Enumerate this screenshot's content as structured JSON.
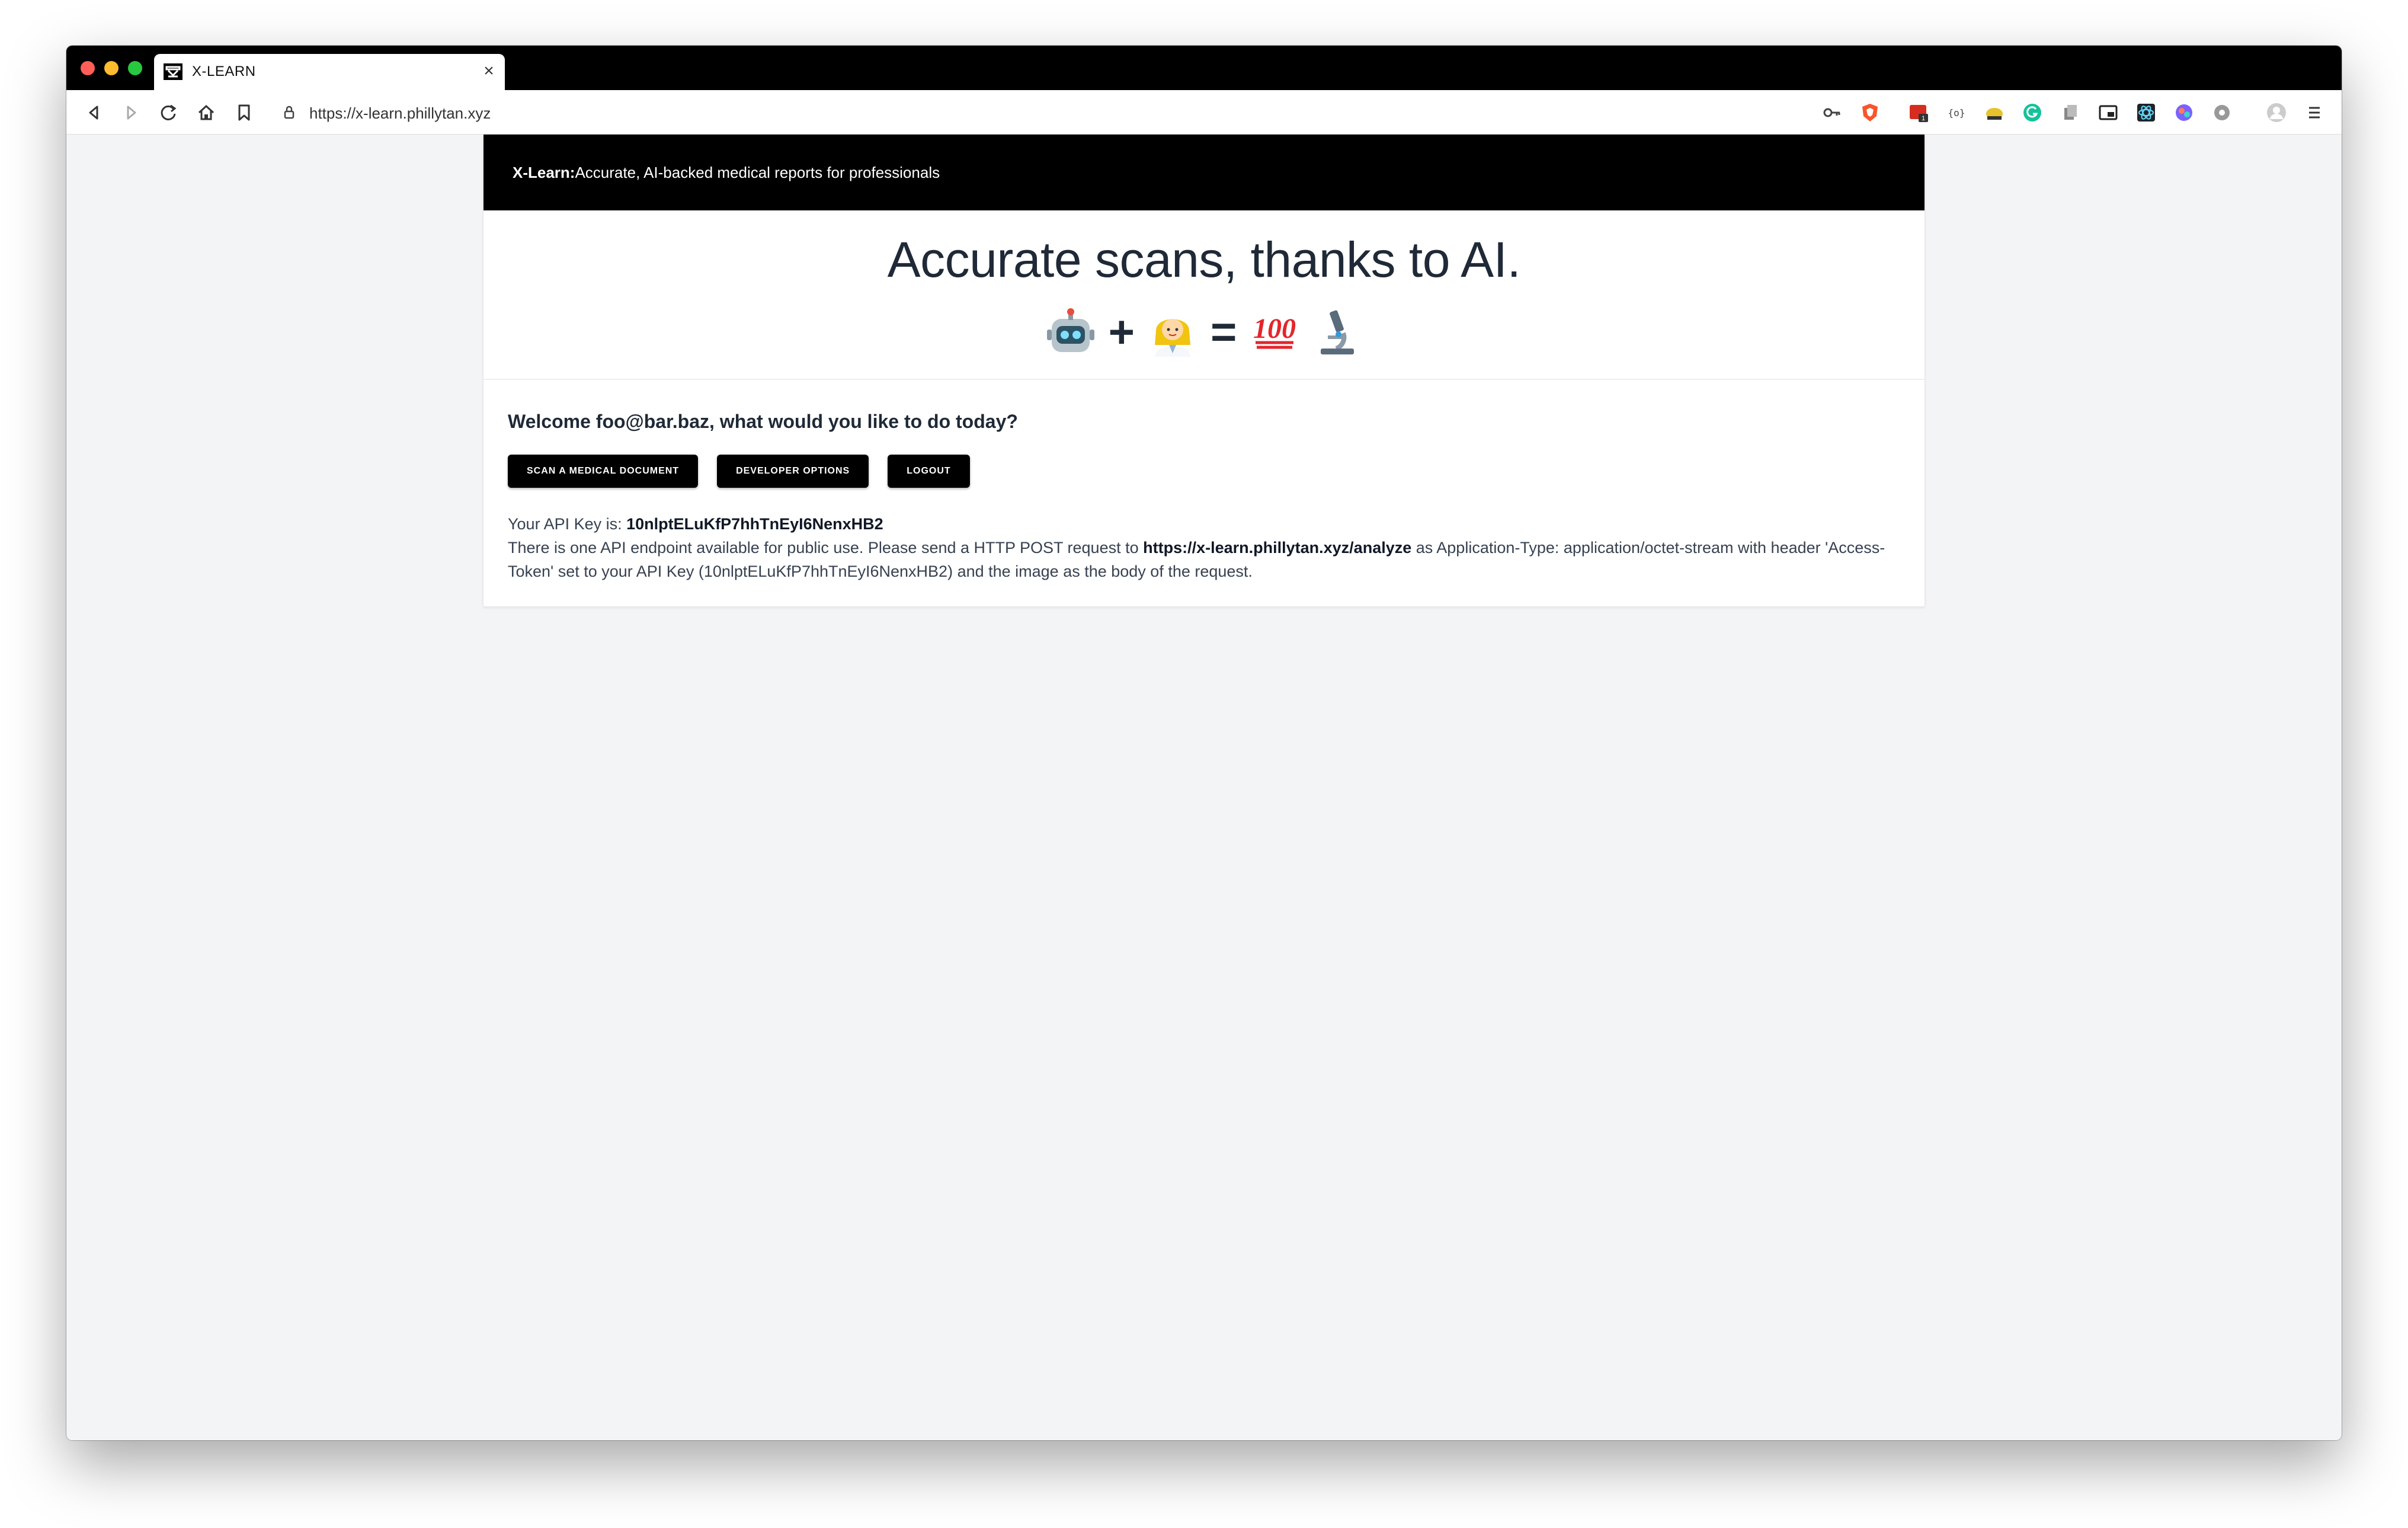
{
  "browser": {
    "tab_title": "X-LEARN",
    "tab_close": "×",
    "new_tab": "+",
    "url": "https://x-learn.phillytan.xyz"
  },
  "header": {
    "brand": "X-Learn:",
    "tagline": "Accurate, AI-backed medical reports for professionals"
  },
  "hero": {
    "title": "Accurate scans, thanks to AI.",
    "plus": "+",
    "equals": "="
  },
  "main": {
    "welcome": "Welcome foo@bar.baz, what would you like to do today?",
    "buttons": {
      "scan": "SCAN A MEDICAL DOCUMENT",
      "developer": "DEVELOPER OPTIONS",
      "logout": "LOGOUT"
    },
    "api_key_label": "Your API Key is: ",
    "api_key": "10nlptELuKfP7hhTnEyI6NenxHB2",
    "endpoint_text_1": "There is one API endpoint available for public use. Please send a HTTP POST request to ",
    "endpoint_url": "https://x-learn.phillytan.xyz/analyze",
    "endpoint_text_2": " as Application-Type: application/octet-stream with header 'Access-Token' set to your API Key (10nlptELuKfP7hhTnEyI6NenxHB2) and the image as the body of the request."
  }
}
